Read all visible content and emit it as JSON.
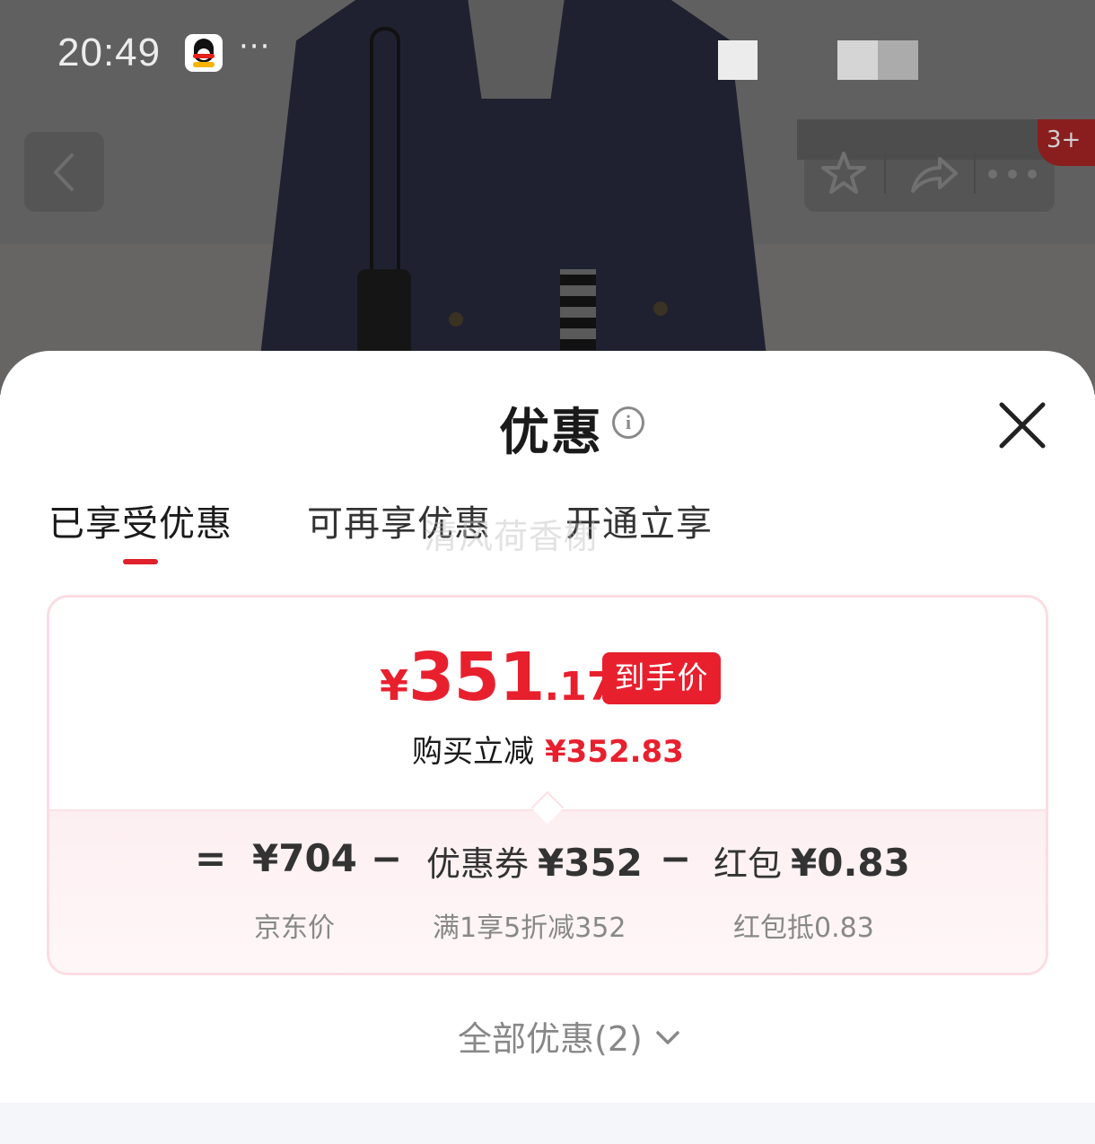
{
  "status_bar": {
    "time": "20:49",
    "more": "···",
    "app_icon": "qq-penguin-icon"
  },
  "nav": {
    "back_icon": "chevron-left-icon",
    "favorite_icon": "star-icon",
    "share_icon": "share-arrow-icon",
    "more_icon": "more-dots-icon",
    "badge_text": "3+"
  },
  "sheet": {
    "title": "优惠",
    "info_icon": "info-icon",
    "close_icon": "close-icon",
    "tabs": [
      {
        "label": "已享受优惠",
        "active": true
      },
      {
        "label": "可再享优惠",
        "active": false
      },
      {
        "label": "开通立享",
        "active": false
      }
    ],
    "watermark": "清风荷香榭",
    "card": {
      "price_yen": "¥",
      "price_int": "351",
      "price_dec": ".17",
      "price_badge": "到手价",
      "instant_off_label": "购买立减",
      "instant_off_amount": "¥352.83",
      "formula": {
        "equals": "=",
        "minus": "−",
        "jd_price": "¥704",
        "coupon_label": "优惠券",
        "coupon_amount": "¥352",
        "redpacket_label": "红包",
        "redpacket_amount": "¥0.83"
      },
      "sub": {
        "jd_price_label": "京东价",
        "coupon_desc": "满1享5折减352",
        "redpacket_desc": "红包抵0.83"
      }
    },
    "all_offers": "全部优惠(2)",
    "all_offers_icon": "chevron-down-icon"
  },
  "colors": {
    "accent_red": "#e8202e",
    "card_border": "#fbdde3",
    "card_bottom_bg": "#fdeff1",
    "text_dark": "#1a1a1a",
    "text_muted": "#888888"
  }
}
